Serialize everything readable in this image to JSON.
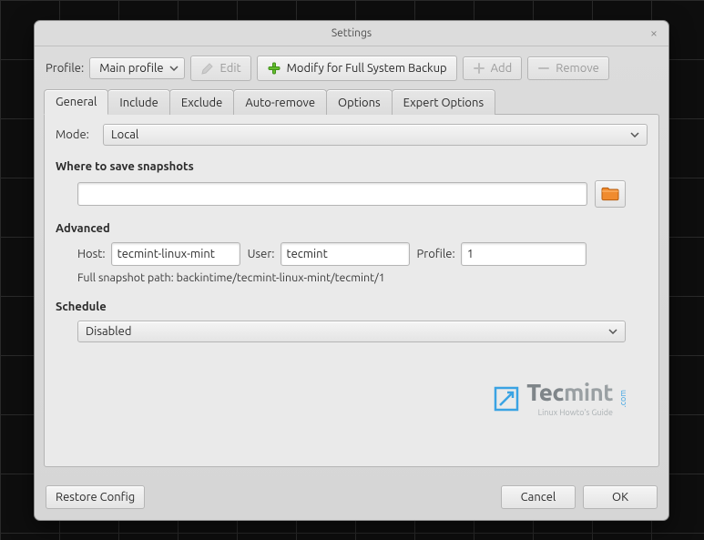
{
  "window": {
    "title": "Settings"
  },
  "toolbar": {
    "profile_label": "Profile:",
    "profile_selected": "Main profile",
    "edit": "Edit",
    "modify": "Modify for Full System Backup",
    "add": "Add",
    "remove": "Remove"
  },
  "tabs": {
    "general": "General",
    "include": "Include",
    "exclude": "Exclude",
    "auto_remove": "Auto-remove",
    "options": "Options",
    "expert": "Expert Options",
    "active": "general"
  },
  "general": {
    "mode_label": "Mode:",
    "mode_value": "Local",
    "where_label": "Where to save snapshots",
    "path_value": "",
    "advanced_label": "Advanced",
    "host_label": "Host:",
    "host_value": "tecmint-linux-mint",
    "user_label": "User:",
    "user_value": "tecmint",
    "profile_label": "Profile:",
    "profile_value": "1",
    "full_path_label": "Full snapshot path: backintime/tecmint-linux-mint/tecmint/1",
    "schedule_label": "Schedule",
    "schedule_value": "Disabled"
  },
  "footer": {
    "restore": "Restore Config",
    "cancel": "Cancel",
    "ok": "OK"
  },
  "watermark": {
    "name_strong": "Tec",
    "name_rest": "mint",
    "sub": "Linux Howto's Guide",
    "dotcom": ".com"
  }
}
